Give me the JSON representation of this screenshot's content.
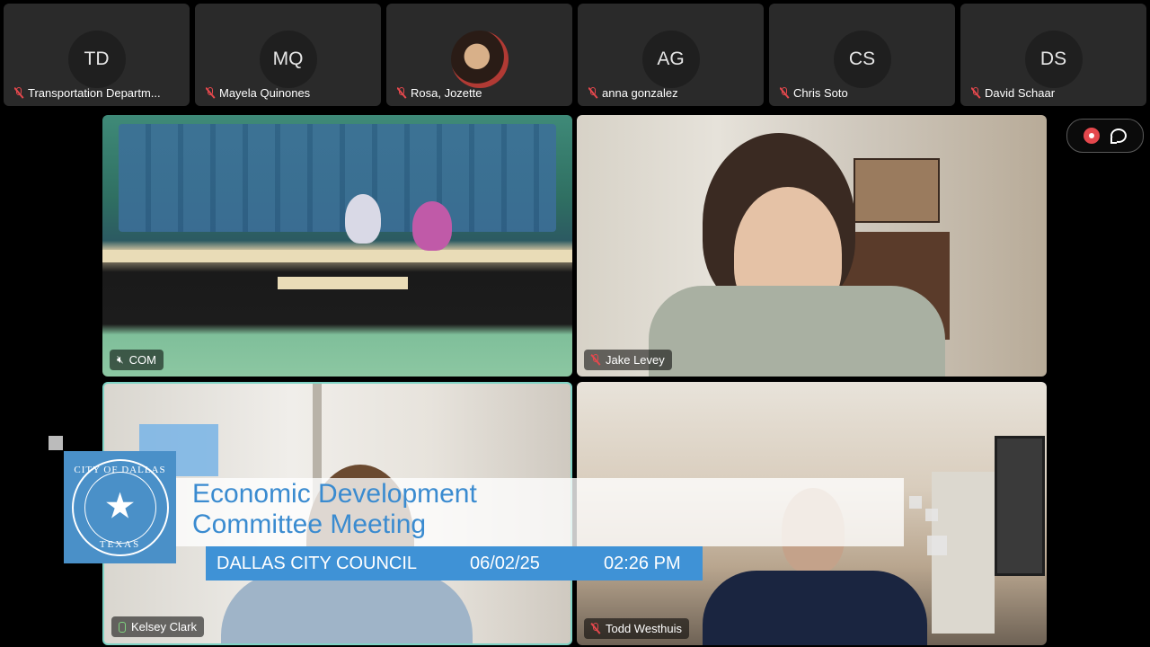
{
  "participants": [
    {
      "initials": "TD",
      "name": "Transportation Departm...",
      "has_photo": false
    },
    {
      "initials": "MQ",
      "name": "Mayela Quinones",
      "has_photo": false
    },
    {
      "initials": "",
      "name": "Rosa, Jozette",
      "has_photo": true
    },
    {
      "initials": "AG",
      "name": "anna gonzalez",
      "has_photo": false
    },
    {
      "initials": "CS",
      "name": "Chris Soto",
      "has_photo": false
    },
    {
      "initials": "DS",
      "name": "David Schaar",
      "has_photo": false
    }
  ],
  "videos": {
    "com": {
      "label": "COM",
      "muted_icon": "speaker-muted-icon"
    },
    "jake": {
      "label": "Jake Levey",
      "muted_icon": "mic-off-icon"
    },
    "kelsey": {
      "label": "Kelsey Clark",
      "muted_icon": "mic-on-icon",
      "active_speaker": true,
      "highlight_color": "#7fd3c5"
    },
    "todd": {
      "label": "Todd Westhuis",
      "muted_icon": "mic-off-icon"
    }
  },
  "controls": {
    "record_icon": "record-icon",
    "chat_icon": "chat-icon"
  },
  "overlay": {
    "seal_top": "CITY OF DALLAS",
    "seal_bottom": "TEXAS",
    "title_line1": "Economic Development",
    "title_line2": "Committee Meeting",
    "organization": "DALLAS CITY COUNCIL",
    "date": "06/02/25",
    "time": "02:26 PM",
    "accent_color": "#3f92d6"
  }
}
